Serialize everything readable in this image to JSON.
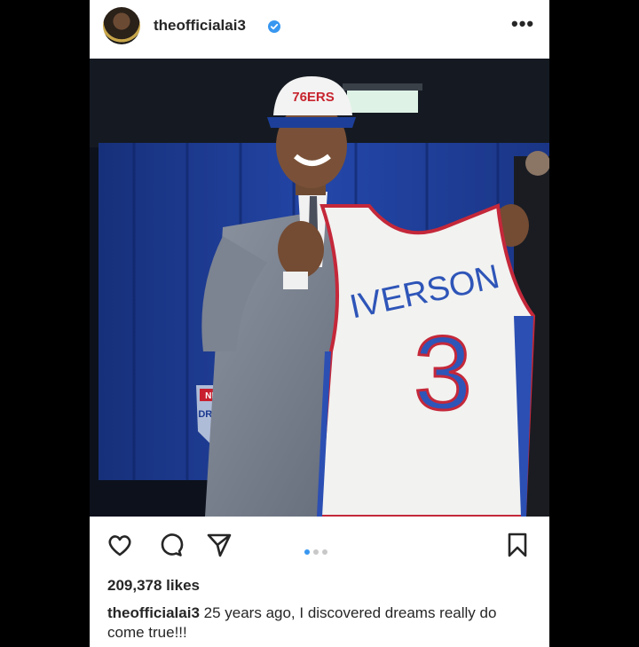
{
  "post": {
    "username": "theofficialai3",
    "likes": "209,378 likes",
    "caption_user": "theofficialai3",
    "caption_text": " 25 years ago, I discovered dreams really do come true!!!"
  },
  "photo": {
    "jersey_name": "IVERSON",
    "jersey_number": "3",
    "hat_text": "76ERS",
    "banner_text": "NBA DRAFT"
  },
  "carousel": {
    "count": 3,
    "active": 0
  },
  "icons": [
    "heart-icon",
    "comment-icon",
    "share-icon",
    "bookmark-icon",
    "more-icon",
    "verified-badge-icon"
  ],
  "colors": {
    "verified": "#3897f0",
    "text": "#262626",
    "backdrop": "#000000"
  }
}
